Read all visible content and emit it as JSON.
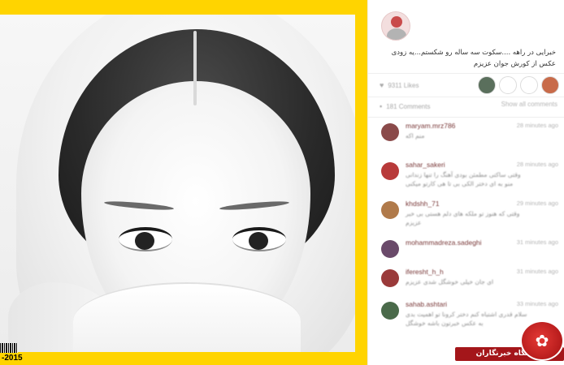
{
  "post": {
    "cover_year": "-2015",
    "caption_line1": "خبرایی در راهه ....سکوت سه ساله رو شکستم...یه زودی",
    "caption_line2": "عکس از کورش جوان عزیزم"
  },
  "stats": {
    "likes": "9311 Likes",
    "comments": "181 Comments",
    "view_all": "Show all comments",
    "liker_colors": [
      "#5a6f5c",
      "#ffffff",
      "#ffffff",
      "#c86b4a"
    ]
  },
  "comments": [
    {
      "user": "maryam.mrz786",
      "time": "28 minutes ago",
      "text": "منم اکه",
      "avatar_color": "#8a4a4a"
    },
    {
      "user": "sahar_sakeri",
      "time": "28 minutes ago",
      "text": "وقتی ساکتی مطمئن بودی آهنگ را تنها زندانی منو به ای دختر الکی بی تا هی کارتو میکنی",
      "avatar_color": "#b83a3a"
    },
    {
      "user": "khdshh_71",
      "time": "29 minutes ago",
      "text": "وقتی که هنوز تو ملکه های دلم هستی بی خبر عزیزم",
      "avatar_color": "#b07a4a"
    },
    {
      "user": "mohammadreza.sadeghi",
      "time": "31 minutes ago",
      "text": "",
      "avatar_color": "#6a4a6a"
    },
    {
      "user": "iferesht_h_h",
      "time": "31 minutes ago",
      "text": "ای جان خیلی خوشگل شدی عزیزم",
      "avatar_color": "#9a3a3a"
    },
    {
      "user": "sahab.ashtari",
      "time": "33 minutes ago",
      "text": "سلام قدری اشتباه کنم دختر کرونا تو اهمیت بدی به عکس خبرتون باشه خوشگل",
      "avatar_color": "#4a6a4a"
    }
  ],
  "watermark": {
    "label": "باشگاه خبرنگاران"
  }
}
